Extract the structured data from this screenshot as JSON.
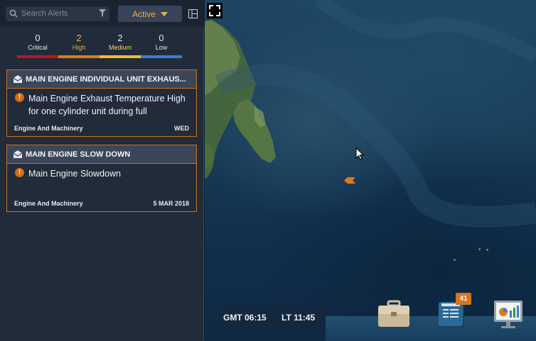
{
  "search": {
    "placeholder": "Search Alerts"
  },
  "filter": {
    "label": "Active"
  },
  "counts": [
    {
      "value": "0",
      "label": "Critical",
      "color": "#c0142a"
    },
    {
      "value": "2",
      "label": "High",
      "color": "#e07d14"
    },
    {
      "value": "2",
      "label": "Medium",
      "color": "#f0c020"
    },
    {
      "value": "0",
      "label": "Low",
      "color": "#3a7fd0"
    }
  ],
  "alerts": [
    {
      "title": "MAIN ENGINE INDIVIDUAL UNIT EXHAUS...",
      "description": "Main Engine Exhaust Temperature High for one cylinder unit during full",
      "category": "Engine And Machinery",
      "date": "WED"
    },
    {
      "title": "MAIN ENGINE SLOW DOWN",
      "description": "Main Engine Slowdown",
      "category": "Engine And Machinery",
      "date": "5 MAR 2018"
    }
  ],
  "clock": {
    "gmt": "GMT 06:15",
    "lt": "LT 11:45"
  },
  "logbook": {
    "badge": "41"
  },
  "colors": {
    "accent": "#f0b23c",
    "alert_border": "#c8731f",
    "panel_bg": "#222b3a"
  }
}
